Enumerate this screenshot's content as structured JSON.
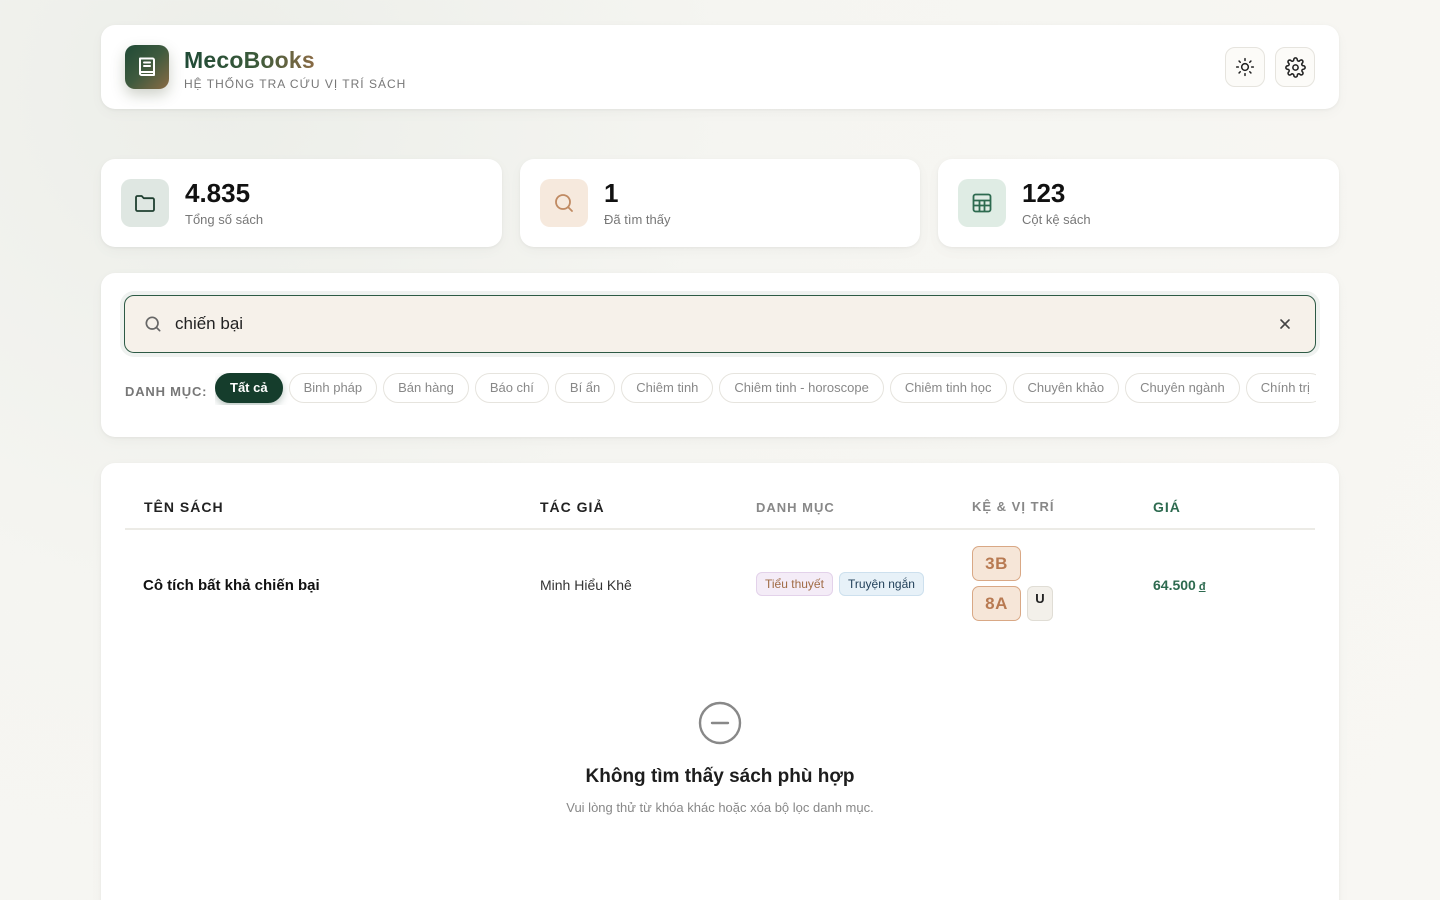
{
  "brand": {
    "name": "MecoBooks",
    "subtitle": "HỆ THỐNG TRA CỨU VỊ TRÍ SÁCH",
    "logo_icon": "book-icon"
  },
  "header_actions": {
    "theme_icon": "sun-icon",
    "settings_icon": "gear-icon"
  },
  "stats": [
    {
      "value": "4.835",
      "label": "Tổng số sách",
      "icon": "folder-icon"
    },
    {
      "value": "1",
      "label": "Đã tìm thấy",
      "icon": "search-icon"
    },
    {
      "value": "123",
      "label": "Cột kệ sách",
      "icon": "grid-icon"
    }
  ],
  "search": {
    "value": "chiến bại",
    "placeholder": "",
    "clear_icon": "close-icon"
  },
  "categories": {
    "label": "DANH MỤC:",
    "items": [
      "Tất cả",
      "Binh pháp",
      "Bán hàng",
      "Báo chí",
      "Bí ẩn",
      "Chiêm tinh",
      "Chiêm tinh - horoscope",
      "Chiêm tinh học",
      "Chuyên khảo",
      "Chuyên ngành",
      "Chính trị"
    ],
    "active": "Tất cả"
  },
  "table": {
    "headers": {
      "title": "TÊN SÁCH",
      "author": "TÁC GIẢ",
      "category": "DANH MỤC",
      "shelf": "KỆ & VỊ TRÍ",
      "price": "GIÁ"
    },
    "rows": [
      {
        "title": "Cô tích bất khả chiến bại",
        "author": "Minh Hiểu Khê",
        "tags": [
          "Tiểu thuyết",
          "Truyện ngắn"
        ],
        "shelves": [
          "3B",
          "8A"
        ],
        "position": "U",
        "price": "64.500",
        "currency": "đ"
      }
    ]
  },
  "empty_state": {
    "icon": "minus-circle-icon",
    "title": "Không tìm thấy sách phù hợp",
    "subtitle": "Vui lòng thử từ khóa khác hoặc xóa bộ lọc danh mục."
  },
  "colors": {
    "primary": "#153d2c",
    "accent": "#8a6b45",
    "price": "#2d6a4f"
  }
}
